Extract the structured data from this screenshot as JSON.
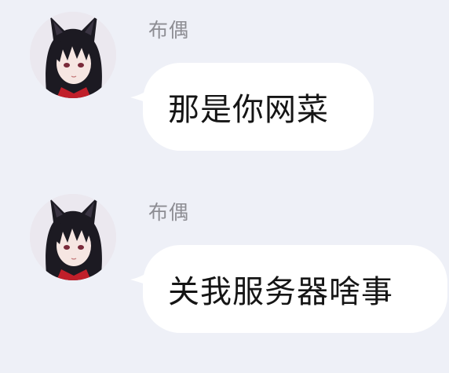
{
  "colors": {
    "background": "#eef0f7",
    "bubble": "#ffffff",
    "sender_name": "#8d8d93",
    "message_text": "#151515"
  },
  "messages": [
    {
      "sender": "布偶",
      "avatar": "cat-ear-girl-avatar",
      "text": "那是你网菜"
    },
    {
      "sender": "布偶",
      "avatar": "cat-ear-girl-avatar",
      "text": "关我服务器啥事"
    }
  ]
}
